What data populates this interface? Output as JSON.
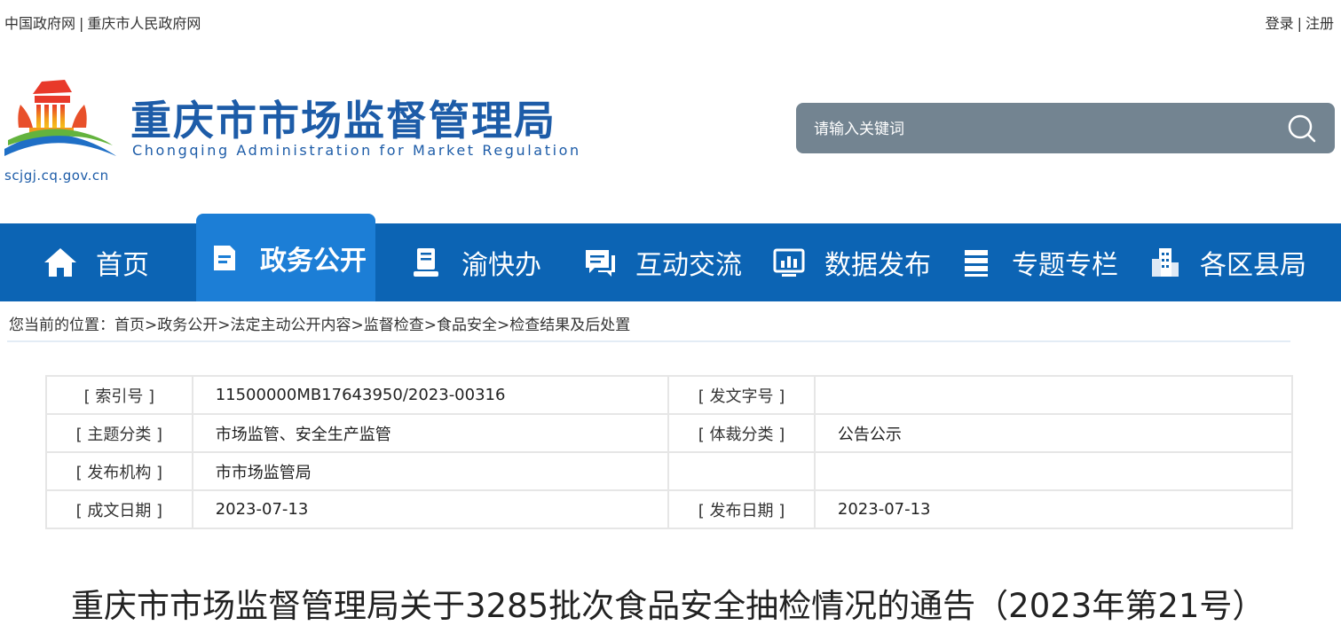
{
  "topbar": {
    "left_links": [
      "中国政府网",
      "重庆市人民政府网"
    ],
    "separator": "|",
    "right_links": [
      "登录",
      "注册"
    ]
  },
  "header": {
    "title": "重庆市市场监督管理局",
    "subtitle": "Chongqing Administration for Market Regulation",
    "domain": "scjgj.cq.gov.cn",
    "search_placeholder": "请输入关键词"
  },
  "nav": {
    "items": [
      {
        "label": "首页",
        "icon": "home-icon"
      },
      {
        "label": "政务公开",
        "icon": "document-icon",
        "active": true
      },
      {
        "label": "渝快办",
        "icon": "service-icon"
      },
      {
        "label": "互动交流",
        "icon": "chat-icon"
      },
      {
        "label": "数据发布",
        "icon": "chart-icon"
      },
      {
        "label": "专题专栏",
        "icon": "column-icon"
      },
      {
        "label": "各区县局",
        "icon": "building-icon"
      }
    ]
  },
  "breadcrumb": {
    "prefix": "您当前的位置：",
    "items": [
      "首页",
      "政务公开",
      "法定主动公开内容",
      "监督检查",
      "食品安全",
      "检查结果及后处置"
    ],
    "separator": ">"
  },
  "meta": {
    "rows": [
      [
        {
          "label": "[ 索引号 ]",
          "value": "11500000MB17643950/2023-00316"
        },
        {
          "label": "[ 发文字号 ]",
          "value": ""
        }
      ],
      [
        {
          "label": "[ 主题分类 ]",
          "value": "市场监管、安全生产监管"
        },
        {
          "label": "[ 体裁分类 ]",
          "value": "公告公示"
        }
      ],
      [
        {
          "label": "[ 发布机构 ]",
          "value": "市市场监管局"
        },
        {
          "label": "",
          "value": ""
        }
      ],
      [
        {
          "label": "[ 成文日期 ]",
          "value": "2023-07-13"
        },
        {
          "label": "[ 发布日期 ]",
          "value": "2023-07-13"
        }
      ]
    ]
  },
  "article": {
    "title": "重庆市市场监督管理局关于3285批次食品安全抽检情况的通告（2023年第21号）"
  },
  "colors": {
    "brand_blue": "#1d5ca8",
    "nav_bg": "#0c64b4",
    "nav_active": "#1c7ed6",
    "search_bg": "#738491"
  }
}
